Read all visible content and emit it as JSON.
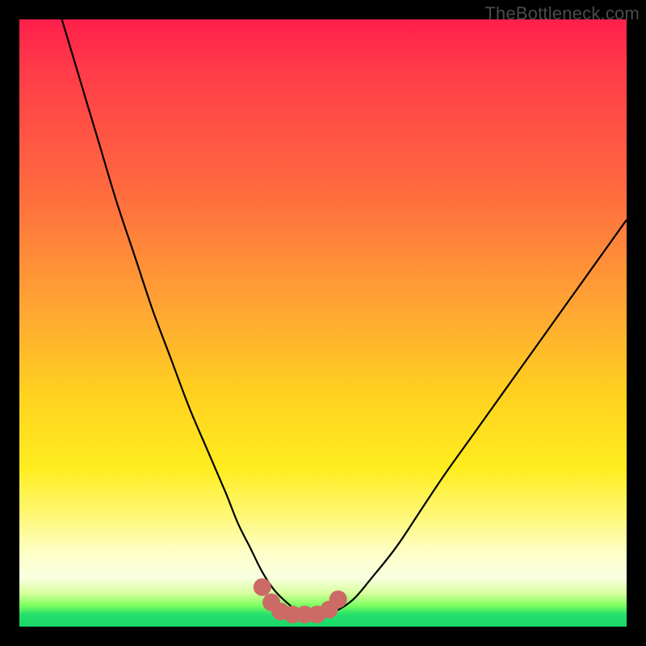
{
  "watermark": "TheBottleneck.com",
  "colors": {
    "frame": "#000000",
    "gradient_top": "#ff1f4b",
    "gradient_mid": "#ffd21f",
    "gradient_bottom": "#18d86a",
    "curve": "#000000",
    "markers": "#cc6b66"
  },
  "chart_data": {
    "type": "line",
    "title": "",
    "xlabel": "",
    "ylabel": "",
    "xlim": [
      0,
      100
    ],
    "ylim": [
      0,
      100
    ],
    "x": [
      7,
      10,
      13,
      16,
      19,
      22,
      25,
      28,
      31,
      34,
      36,
      38,
      40,
      42,
      44,
      46,
      48,
      50,
      52,
      55,
      58,
      62,
      66,
      70,
      75,
      80,
      85,
      90,
      95,
      100
    ],
    "values": [
      100,
      90,
      80,
      70,
      61,
      52,
      44,
      36,
      29,
      22,
      17,
      13,
      9,
      6,
      4,
      2.5,
      2,
      2,
      2.5,
      4.5,
      8,
      13,
      19,
      25,
      32,
      39,
      46,
      53,
      60,
      67
    ],
    "markers": {
      "x": [
        40,
        41.5,
        43,
        45,
        47,
        49,
        51,
        52.5
      ],
      "y": [
        6.5,
        4,
        2.5,
        2,
        2,
        2,
        2.8,
        4.5
      ]
    },
    "grid": false,
    "legend": false
  }
}
